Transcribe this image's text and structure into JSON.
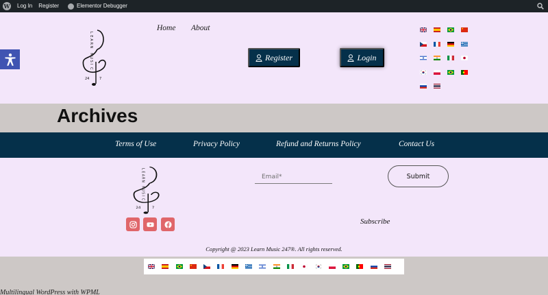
{
  "adminbar": {
    "login": "Log In",
    "register": "Register",
    "debugger": "Elementor Debugger"
  },
  "logo": {
    "letters": [
      "L",
      "E",
      "A",
      "R",
      "N",
      " ",
      "M",
      "U",
      "S",
      "I",
      "C"
    ],
    "numbers": [
      "24",
      "7"
    ]
  },
  "nav": {
    "home": "Home",
    "about": "About"
  },
  "buttons": {
    "register": "Register",
    "login": "Login"
  },
  "page_title": "Archives",
  "footer_menu": [
    "Terms of Use",
    "Privacy Policy",
    "Refund and Returns Policy",
    "Contact Us"
  ],
  "newsletter": {
    "email_placeholder": "Email*",
    "submit": "Submit",
    "subscribe": "Subscribe"
  },
  "copyright": "Copyright @ 2023 Learn Music 247®.  All rights reserved.",
  "wpml": "Multilingual WordPress with WPML",
  "icons": {
    "header_flags": [
      "flag-uk",
      "flag-spain",
      "flag-brazil",
      "flag-china",
      "flag-czech",
      "flag-france",
      "flag-germany",
      "flag-greece",
      "flag-israel",
      "flag-india",
      "flag-italy",
      "flag-japan",
      "flag-korea",
      "flag-poland",
      "flag-brazil",
      "flag-portugal",
      "flag-russia",
      "flag-thailand"
    ],
    "footer_flags": [
      "flag-uk",
      "flag-spain",
      "flag-brazil",
      "flag-china",
      "flag-czech",
      "flag-france",
      "flag-germany",
      "flag-greece",
      "flag-israel",
      "flag-india",
      "flag-italy",
      "flag-japan",
      "flag-korea",
      "flag-poland",
      "flag-brazil",
      "flag-portugal",
      "flag-russia",
      "flag-thailand"
    ],
    "social": [
      "instagram-icon",
      "youtube-icon",
      "facebook-icon"
    ]
  },
  "colors": {
    "page_bg": "#f3e6fa",
    "navy": "#05304a",
    "band_gray": "#cdc8c6",
    "social_red": "#e0666a",
    "a11y_blue": "#4054b2"
  }
}
